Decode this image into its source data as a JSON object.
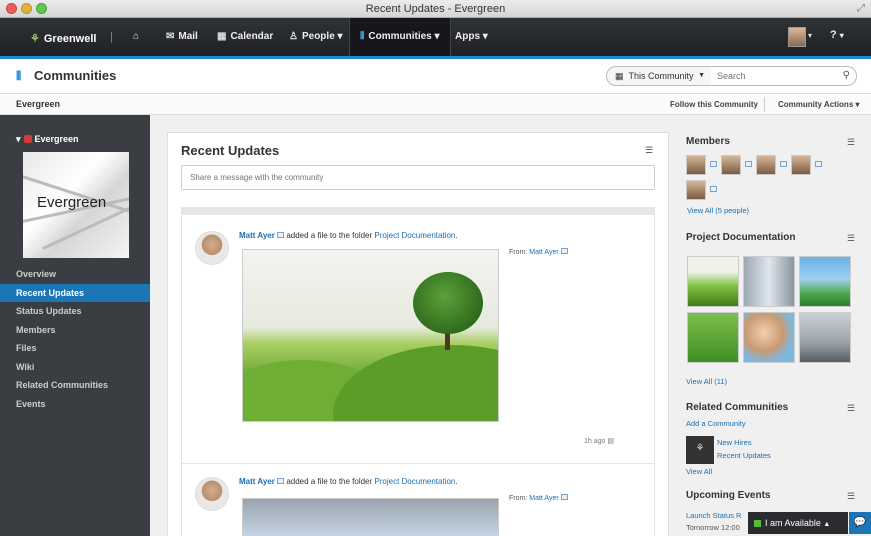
{
  "window": {
    "title": "Recent Updates - Evergreen"
  },
  "nav": {
    "brand": "Greenwell",
    "items": [
      {
        "label": "Mail",
        "icon": "mail-icon"
      },
      {
        "label": "Calendar",
        "icon": "calendar-icon"
      },
      {
        "label": "People",
        "icon": "person-icon"
      },
      {
        "label": "Communities",
        "icon": "communities-icon"
      },
      {
        "label": "Apps",
        "icon": ""
      }
    ],
    "caret": "▾",
    "help": "?"
  },
  "community_bar": {
    "title": "Communities",
    "scope": "This Community",
    "search_placeholder": "Search"
  },
  "subbar": {
    "title": "Evergreen",
    "follow": "Follow this Community",
    "actions": "Community Actions ▾"
  },
  "sidebar": {
    "community": "Evergreen",
    "image_text": "Evergreen",
    "items": [
      "Overview",
      "Recent Updates",
      "Status Updates",
      "Members",
      "Files",
      "Wiki",
      "Related Communities",
      "Events"
    ],
    "active_index": 1
  },
  "main": {
    "title": "Recent Updates",
    "share_placeholder": "Share a message with the community",
    "entries": [
      {
        "author": "Matt Ayer",
        "action": "added a file to the folder",
        "folder": "Project Documentation",
        "from_label": "From:",
        "from": "Matt Ayer",
        "time": "1h ago"
      },
      {
        "author": "Matt Ayer",
        "action": "added a file to the folder",
        "folder": "Project Documentation",
        "from_label": "From:",
        "from": "Matt Ayer"
      }
    ]
  },
  "right": {
    "members": {
      "title": "Members",
      "view_all": "View All (5 people)"
    },
    "docs": {
      "title": "Project Documentation",
      "view_all": "View All (11)"
    },
    "related": {
      "title": "Related Communities",
      "add": "Add a Community",
      "items": [
        "New Hires",
        "Recent Updates"
      ],
      "view_all": "View All"
    },
    "events": {
      "title": "Upcoming Events",
      "item": "Launch Status R",
      "time": "Tomorrow 12:00"
    }
  },
  "chat": {
    "status": "I am Available"
  }
}
